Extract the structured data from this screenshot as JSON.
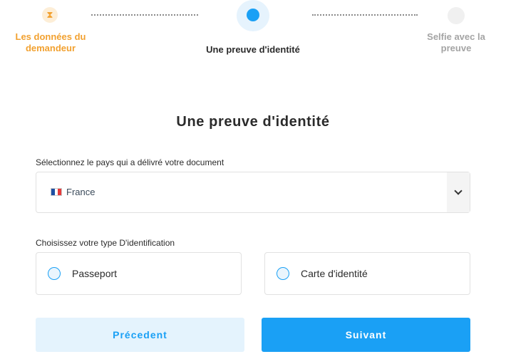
{
  "stepper": {
    "steps": [
      {
        "label": "Les données du demandeur",
        "state": "completed",
        "icon": "hourglass-icon",
        "color": "#f2a130"
      },
      {
        "label": "Une preuve d'identité",
        "state": "active",
        "color": "#1aa0f5"
      },
      {
        "label": "Selfie avec la preuve",
        "state": "pending",
        "color": "#a4a4a4"
      }
    ],
    "hourglass_glyph": "⧗"
  },
  "main": {
    "title": "Une preuve d'identité",
    "country": {
      "label": "Sélectionnez le pays qui a délivré votre document",
      "selected": "France",
      "flag_colors": [
        "#1e4fa3",
        "#ffffff",
        "#e63b3b"
      ]
    },
    "id_type": {
      "label": "Choisissez votre type D'identification",
      "options": [
        {
          "label": "Passeport",
          "selected": false
        },
        {
          "label": "Carte d'identité",
          "selected": false
        }
      ]
    }
  },
  "buttons": {
    "previous_label": "Précedent",
    "next_label": "Suivant"
  },
  "colors": {
    "accent": "#1aa0f5",
    "completed": "#f2a130",
    "pending": "#a4a4a4"
  }
}
